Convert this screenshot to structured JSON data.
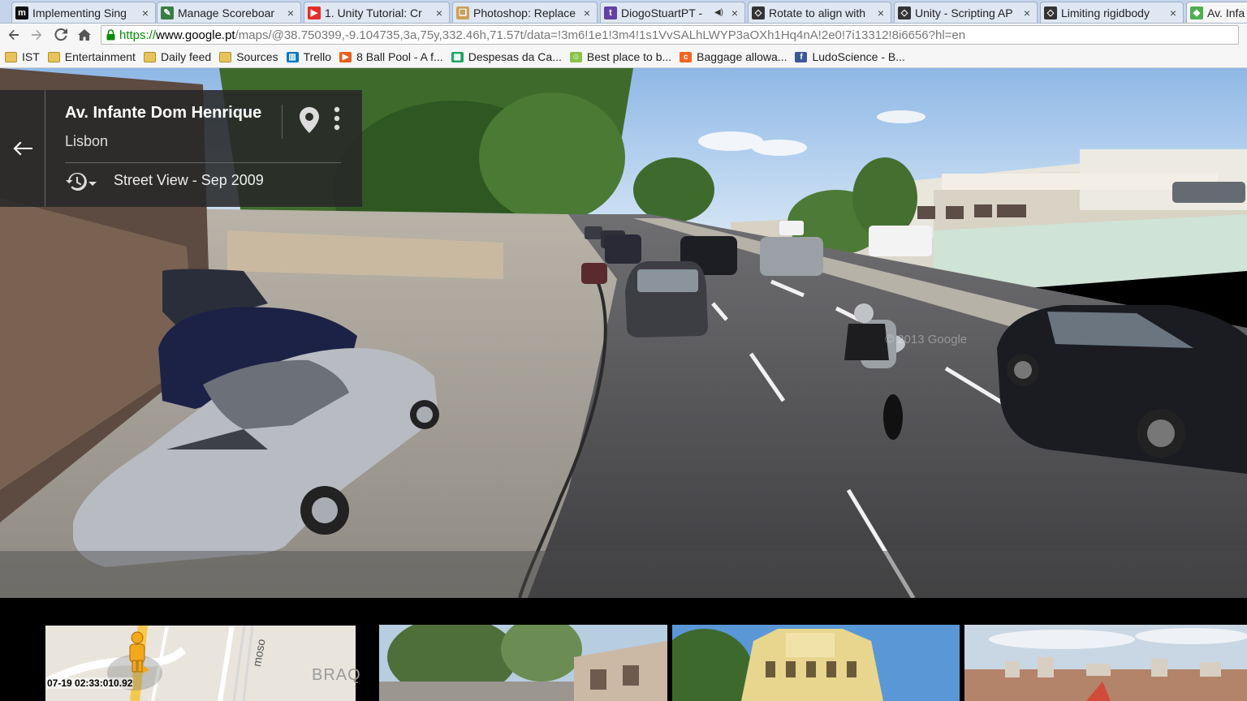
{
  "browser": {
    "tabs": [
      {
        "title": "Implementing Sing",
        "icon": "medium-icon",
        "color": "#111111",
        "active": false
      },
      {
        "title": "Manage Scoreboar",
        "icon": "pencil-icon",
        "color": "#3a7d44",
        "active": false
      },
      {
        "title": "1. Unity Tutorial: Cr",
        "icon": "youtube-icon",
        "color": "#e52d27",
        "active": false
      },
      {
        "title": "Photoshop: Replace",
        "icon": "document-icon",
        "color": "#c9a15c",
        "active": false
      },
      {
        "title": "DiogoStuartPT -",
        "icon": "twitch-icon",
        "color": "#6441a5",
        "active": false,
        "audio": true
      },
      {
        "title": "Rotate to align with",
        "icon": "unity-icon",
        "color": "#333333",
        "active": false
      },
      {
        "title": "Unity - Scripting AP",
        "icon": "unity-icon",
        "color": "#333333",
        "active": false
      },
      {
        "title": "Limiting rigidbody",
        "icon": "unity-icon",
        "color": "#333333",
        "active": false
      },
      {
        "title": "Av. Infa",
        "icon": "google-maps-icon",
        "color": "#4caf50",
        "active": true
      }
    ],
    "close_glyph": "×",
    "audio_glyph": "◀)",
    "address": {
      "scheme": "https://",
      "host": "www.google.pt",
      "path": "/maps/@38.750399,-9.104735,3a,75y,332.46h,71.57t/data=!3m6!1e1!3m4!1s1VvSALhLWYP3aOXh1Hq4nA!2e0!7i13312!8i6656?hl=en"
    },
    "bookmarks": [
      {
        "label": "IST",
        "icon": "folder-icon"
      },
      {
        "label": "Entertainment",
        "icon": "folder-icon"
      },
      {
        "label": "Daily feed",
        "icon": "folder-icon"
      },
      {
        "label": "Sources",
        "icon": "folder-icon"
      },
      {
        "label": "Trello",
        "icon": "trello-icon",
        "color": "#0079bf"
      },
      {
        "label": "8 Ball Pool - A f...",
        "icon": "play-icon",
        "color": "#e8601c"
      },
      {
        "label": "Despesas da Ca...",
        "icon": "sheets-icon",
        "color": "#1fa463"
      },
      {
        "label": "Best place to b...",
        "icon": "smiley-icon",
        "color": "#8bc34a"
      },
      {
        "label": "Baggage allowa...",
        "icon": "orange-c-icon",
        "color": "#f26522"
      },
      {
        "label": "LudoScience - B...",
        "icon": "facebook-icon",
        "color": "#3b5998"
      }
    ]
  },
  "streetview": {
    "street": "Av. Infante Dom Henrique",
    "city": "Lisbon",
    "date_label": "Street View - Sep 2009",
    "watermark": "© 2013 Google"
  },
  "bottom": {
    "timestamp": "07-19 02:33:010.92",
    "map_label_1": "BRAQ",
    "map_label_2": "mosо"
  }
}
